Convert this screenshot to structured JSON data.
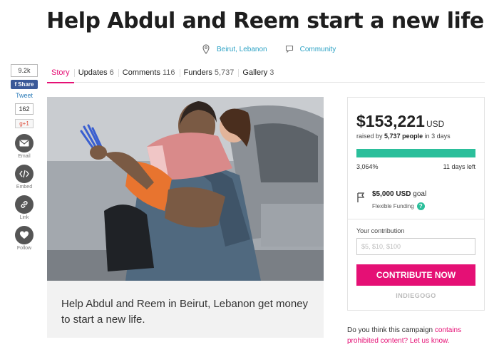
{
  "page": {
    "title": "Help Abdul and Reem start a new life",
    "location": "Beirut, Lebanon",
    "category": "Community"
  },
  "share": {
    "fb_count": "9.2k",
    "fb_share_label": "Share",
    "tweet_label": "Tweet",
    "gplus_count": "162",
    "gplus_label": "g+1",
    "email_label": "Email",
    "embed_label": "Embed",
    "link_label": "Link",
    "follow_label": "Follow"
  },
  "tabs": [
    {
      "label": "Story",
      "count": ""
    },
    {
      "label": "Updates",
      "count": "6"
    },
    {
      "label": "Comments",
      "count": "116"
    },
    {
      "label": "Funders",
      "count": "5,737"
    },
    {
      "label": "Gallery",
      "count": "3"
    }
  ],
  "story": {
    "summary": "Help Abdul and Reem in Beirut, Lebanon get money to start a new life."
  },
  "funding": {
    "amount": "$153,221",
    "currency": "USD",
    "raised_prefix": "raised by",
    "people": "5,737 people",
    "duration": "in 3 days",
    "percent": "3,064%",
    "progress_fraction": 1.0,
    "days_left": "11 days left",
    "goal_amount": "$5,000",
    "goal_currency": "USD",
    "goal_suffix": "goal",
    "funding_type": "Flexible Funding",
    "help_mark": "?",
    "contribution_label": "Your contribution",
    "contribution_placeholder": "$5, $10, $100",
    "cta_label": "CONTRIBUTE NOW",
    "brand": "INDIEGOGO"
  },
  "report": {
    "prefix": "Do you think this campaign",
    "link1": "contains prohibited content?",
    "link2": "Let us know."
  },
  "colors": {
    "accent": "#e51075",
    "progress": "#2bbf9b",
    "link": "#2aa1c4",
    "facebook": "#3b5998"
  },
  "icons": {
    "location": "map-pin-icon",
    "category": "speech-bubble-icon",
    "email": "envelope-icon",
    "embed": "code-icon",
    "link": "chain-link-icon",
    "follow": "heart-icon",
    "goal": "flag-icon"
  }
}
